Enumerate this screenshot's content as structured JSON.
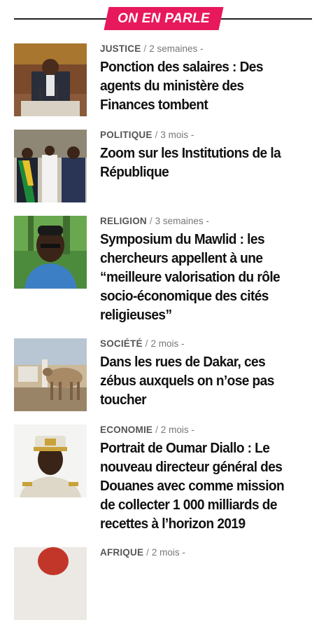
{
  "section": {
    "title": "ON EN PARLE",
    "accent": "#e8185c"
  },
  "articles": [
    {
      "category": "JUSTICE",
      "time": "2 semaines -",
      "title": "Ponction des salaires : Des agents du ministère des Finances tombent"
    },
    {
      "category": "POLITIQUE",
      "time": "3 mois -",
      "title": "Zoom sur les Institutions de la République"
    },
    {
      "category": "RELIGION",
      "time": "3 semaines -",
      "title": "Symposium du Mawlid : les chercheurs appellent à une “meilleure valorisation du rôle socio-économique des cités religieuses”"
    },
    {
      "category": "SOCIÉTÉ",
      "time": "2 mois -",
      "title": "Dans les rues de Dakar, ces zébus auxquels on n’ose pas toucher"
    },
    {
      "category": "ECONOMIE",
      "time": "2 mois -",
      "title": "Portrait de Oumar Diallo : Le nouveau directeur général des Douanes avec comme mission de collecter 1 000 milliards de recettes à l’horizon 2019"
    },
    {
      "category": "AFRIQUE",
      "time": "2 mois -",
      "title": ""
    }
  ]
}
